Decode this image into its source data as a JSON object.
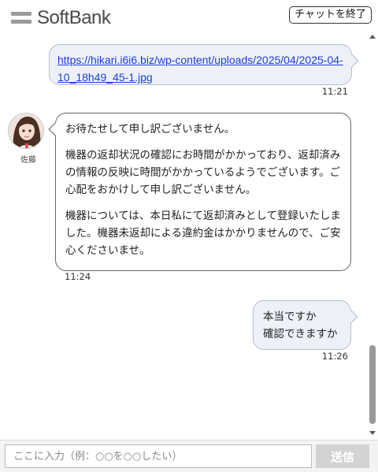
{
  "header": {
    "logo_text": "SoftBank",
    "end_chat_label": "チャットを終了"
  },
  "messages": [
    {
      "sender": "user",
      "link_text": "https://hikari.i6i6.biz/wp-content/uploads/2025/04/2025-04-10_18h49_45-1.jpg",
      "time": "11:21"
    },
    {
      "sender": "agent",
      "agent_name": "佐藤",
      "paragraphs": [
        "お待たせして申し訳ございません。",
        "機器の返却状況の確認にお時間がかかっており、返却済みの情報の反映に時間がかかっているようでございます。ご心配をおかけして申し訳ございません。",
        "機器については、本日私にて返却済みとして登録いたしました。機器未返却による違約金はかかりませんので、ご安心くださいませ。"
      ],
      "time": "11:24"
    },
    {
      "sender": "user",
      "lines": [
        "本当ですか",
        "確認できますか"
      ],
      "time": "11:26"
    }
  ],
  "input": {
    "placeholder": "ここに入力（例：○○を○○したい）",
    "value": "",
    "send_label": "送信"
  },
  "colors": {
    "user_bubble": "#eef0f8",
    "link": "#1a3fd8",
    "send_button": "#d3d3d3"
  }
}
